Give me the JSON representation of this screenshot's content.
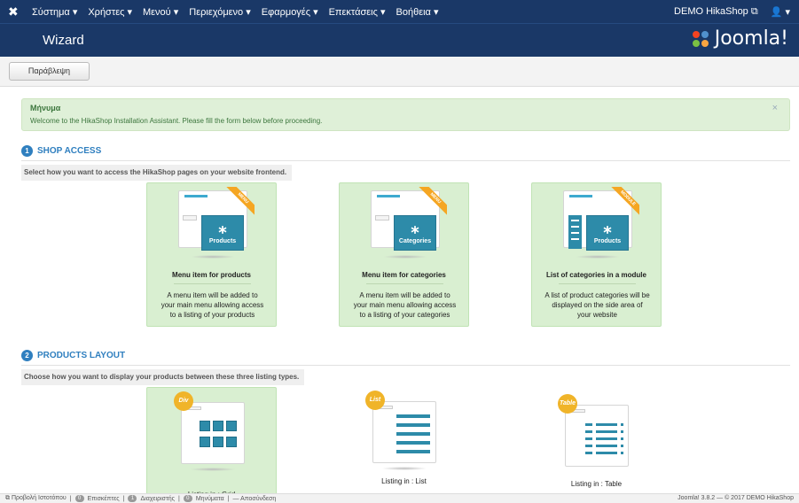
{
  "topbar": {
    "menus": [
      "Σύστημα ▾",
      "Χρήστες ▾",
      "Μενού ▾",
      "Περιεχόμενο ▾",
      "Εφαρμογές ▾",
      "Επεκτάσεις ▾",
      "Βοήθεια ▾"
    ],
    "site_link": "DEMO HikaShop ⧉",
    "user_menu": "👤 ▾"
  },
  "header": {
    "title": "Wizard",
    "brand": "Joomla!"
  },
  "toolbar": {
    "skip_label": "Παράβλεψη"
  },
  "alert": {
    "heading": "Μήνυμα",
    "text": "Welcome to the HikaShop Installation Assistant. Please fill the form below before proceeding.",
    "close": "×"
  },
  "shop_access": {
    "number": "1",
    "title": "SHOP ACCESS",
    "hint": "Select how you want to access the HikaShop pages on your website frontend.",
    "options": [
      {
        "ribbon": "MENU",
        "tile": "Products",
        "title": "Menu item for products",
        "desc": "A menu item will be added to your main menu allowing access to a listing of your products"
      },
      {
        "ribbon": "MENU",
        "tile": "Categories",
        "title": "Menu item for categories",
        "desc": "A menu item will be added to your main menu allowing access to a listing of your categories"
      },
      {
        "ribbon": "MODULE",
        "tile": "Products",
        "title": "List of categories in a module",
        "desc": "A list of product categories will be displayed on the side area of your website"
      }
    ]
  },
  "products_layout": {
    "number": "2",
    "title": "PRODUCTS LAYOUT",
    "hint": "Choose how you want to display your products between these three listing types.",
    "options": [
      {
        "badge": "Div",
        "caption": "Listing in : Grid"
      },
      {
        "badge": "List",
        "caption": "Listing in : List"
      },
      {
        "badge": "Table",
        "caption": "Listing in : Table"
      }
    ]
  },
  "footer": {
    "view_site": "⧉ Προβολή Ιστοτόπου",
    "visitors_count": "0",
    "visitors": "Επισκέπτες",
    "admins_count": "1",
    "admins": "Διαχειριστής",
    "messages_count": "0",
    "messages": "Μηνύματα",
    "logout": "— Αποσύνδεση",
    "version": "Joomla! 3.8.2 — © 2017 DEMO HikaShop"
  }
}
